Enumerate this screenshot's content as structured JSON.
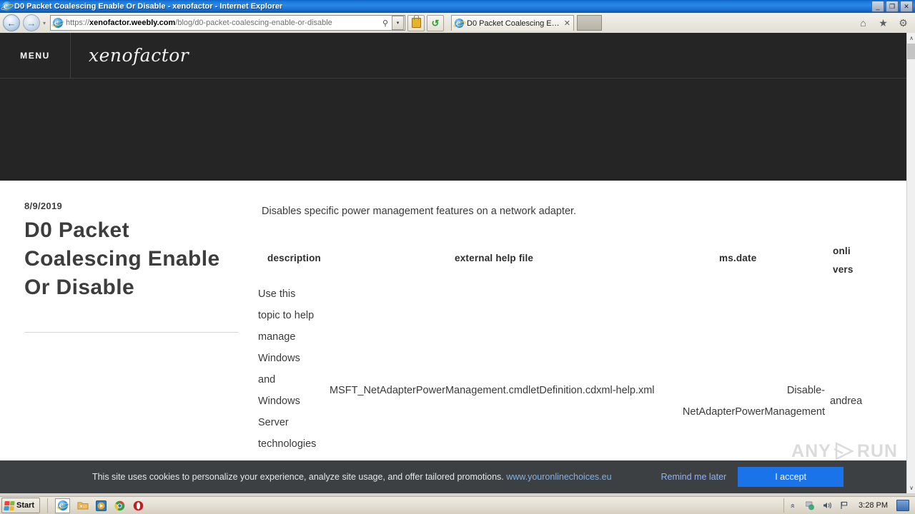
{
  "window": {
    "title": "D0 Packet Coalescing Enable Or Disable - xenofactor - Internet Explorer",
    "minimize_label": "_",
    "maximize_label": "❐",
    "close_label": "✕"
  },
  "browser": {
    "back_label": "←",
    "forward_label": "→",
    "history_caret": "▾",
    "address": {
      "scheme": "https",
      "separator": "://",
      "subdomain": "xenofactor",
      "domain": ".weebly.com",
      "path": "/blog/d0-packet-coalescing-enable-or-disable",
      "full": "https://xenofactor.weebly.com/blog/d0-packet-coalescing-enable-or-disable",
      "search_icon": "⚲",
      "dropdown_caret": "▾"
    },
    "toolbar": {
      "security_lock": "lock-icon",
      "compatibility": "↺"
    },
    "tab": {
      "title": "D0 Packet Coalescing Enable...",
      "close": "✕"
    },
    "newtab_label": "",
    "right_icons": {
      "home": "⌂",
      "favorites": "★",
      "tools": "⚙"
    }
  },
  "site": {
    "menu_label": "MENU",
    "brand": "xenofactor"
  },
  "post": {
    "date": "8/9/2019",
    "title": "D0 Packet Coalescing Enable Or Disable",
    "intro": "Disables specific power management features on a network adapter."
  },
  "table": {
    "headers": {
      "description": "description",
      "external_help_file": "external help file",
      "ms_date": "ms.date",
      "online_version_line1": "onli",
      "online_version_line2": "vers"
    },
    "cells": {
      "description": "Use this topic to help manage Windows and Windows Server technologies",
      "external_help_file": "MSFT_NetAdapterPowerManagement.cmdletDefinition.cdxml-help.xml",
      "ms_date": "Disable-NetAdapterPowerManagement",
      "online_version": "andrea"
    }
  },
  "cookie_banner": {
    "message": "This site uses cookies to personalize your experience, analyze site usage, and offer tailored promotions.",
    "link_text": "www.youronlinechoices.eu",
    "remind_label": "Remind me later",
    "accept_label": "I accept",
    "accent_color": "#1a73e8",
    "background_color": "#3c4043"
  },
  "watermark": {
    "left_text": "ANY",
    "right_text": "RUN"
  },
  "scrollbar": {
    "up_arrow": "∧",
    "down_arrow": "∨"
  },
  "taskbar": {
    "start_label": "Start",
    "quick_launch": [
      "internet-explorer-icon",
      "folder-explorer-icon",
      "media-player-icon",
      "chrome-icon",
      "opera-icon"
    ],
    "tray": {
      "expand": "»",
      "network_icon": "network-icon",
      "volume_icon": "⧖",
      "flag_icon": "⚑",
      "clock": "3:28 PM"
    }
  }
}
